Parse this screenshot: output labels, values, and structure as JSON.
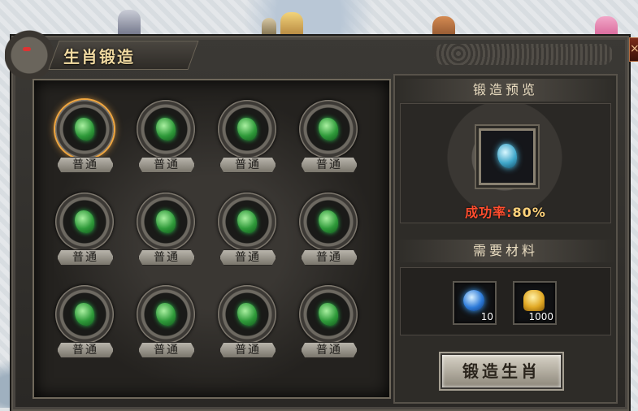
{
  "window": {
    "title": "生肖锻造",
    "close_label": "×"
  },
  "grid": {
    "slots": [
      {
        "label": "普通",
        "selected": true
      },
      {
        "label": "普通",
        "selected": false
      },
      {
        "label": "普通",
        "selected": false
      },
      {
        "label": "普通",
        "selected": false
      },
      {
        "label": "普通",
        "selected": false
      },
      {
        "label": "普通",
        "selected": false
      },
      {
        "label": "普通",
        "selected": false
      },
      {
        "label": "普通",
        "selected": false
      },
      {
        "label": "普通",
        "selected": false
      },
      {
        "label": "普通",
        "selected": false
      },
      {
        "label": "普通",
        "selected": false
      },
      {
        "label": "普通",
        "selected": false
      }
    ]
  },
  "preview": {
    "heading": "锻造预览",
    "rate_label": "成功率:",
    "rate_value": "80%"
  },
  "materials": {
    "heading": "需要材料",
    "items": [
      {
        "icon": "blue-gem-icon",
        "count": "10"
      },
      {
        "icon": "gold-ingot-icon",
        "count": "1000"
      }
    ]
  },
  "actions": {
    "forge_label": "锻造生肖"
  },
  "colors": {
    "accent_gold": "#f0a640",
    "rate_red": "#ff4d2e",
    "jade_green": "#2f9a3a"
  }
}
